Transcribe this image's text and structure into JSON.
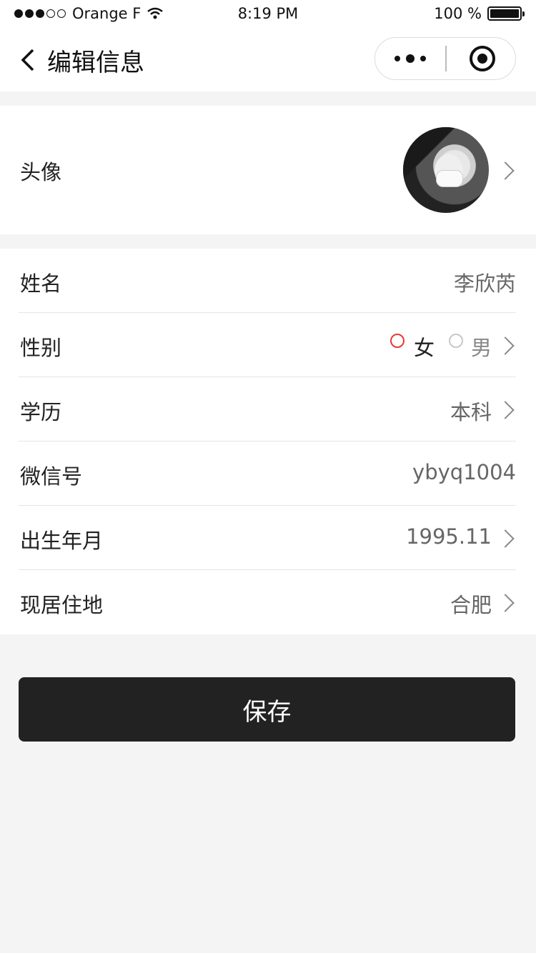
{
  "status_bar": {
    "carrier": "Orange F",
    "time": "8:19 PM",
    "battery": "100 %",
    "signal_bars_filled": 3,
    "signal_bars_total": 5
  },
  "nav": {
    "title": "编辑信息",
    "back_icon": "chevron-left-icon",
    "more_icon": "more-dots-icon",
    "close_icon": "target-circle-icon"
  },
  "profile": {
    "avatar_label": "头像",
    "name_label": "姓名",
    "name_value": "李欣芮",
    "gender_label": "性别",
    "gender_female": "女",
    "gender_male": "男",
    "gender_selected": "女",
    "education_label": "学历",
    "education_value": "本科",
    "wechat_label": "微信号",
    "wechat_value": "ybyq1004",
    "birth_label": "出生年月",
    "birth_value": "1995.11",
    "residence_label": "现居住地",
    "residence_value": "合肥"
  },
  "actions": {
    "save_label": "保存"
  },
  "colors": {
    "accent_radio": "#e53935",
    "button_bg": "#222222",
    "page_bg": "#f4f4f4"
  }
}
